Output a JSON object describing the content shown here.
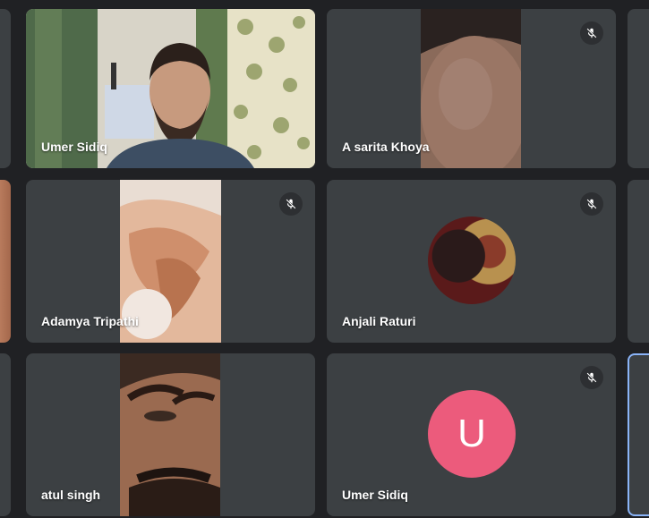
{
  "participants": [
    {
      "name": "Umer Sidiq",
      "muted": false,
      "type": "video"
    },
    {
      "name": "A sarita Khoya",
      "muted": true,
      "type": "video"
    },
    {
      "name": "Adamya Tripathi",
      "muted": true,
      "type": "video"
    },
    {
      "name": "Anjali Raturi",
      "muted": true,
      "type": "avatar-photo"
    },
    {
      "name": "atul singh",
      "muted": false,
      "type": "video"
    },
    {
      "name": "Umer Sidiq",
      "muted": true,
      "type": "avatar-letter",
      "initial": "U",
      "avatar_color": "#ec5b7c"
    }
  ],
  "colors": {
    "background": "#202124",
    "tile": "#3c4043",
    "active_outline": "#8ab4f8"
  },
  "icons": {
    "mute": "mic-off-icon"
  }
}
